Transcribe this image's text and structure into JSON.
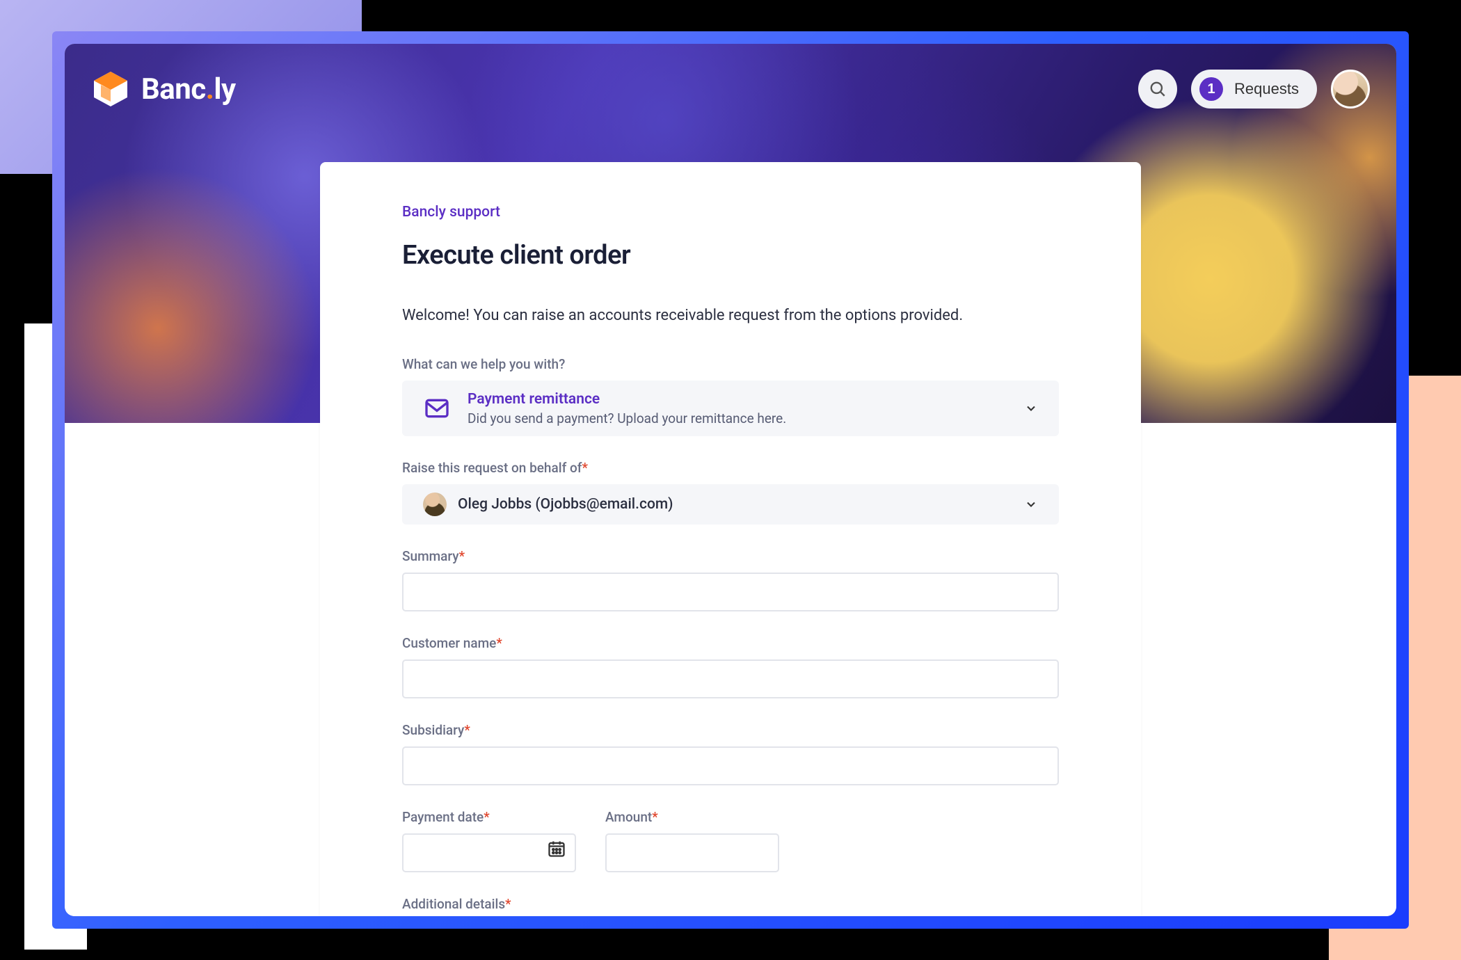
{
  "brand": {
    "name_pre": "Banc",
    "name_post": "ly"
  },
  "topbar": {
    "requests_count": "1",
    "requests_label": "Requests"
  },
  "breadcrumb": "Bancly support",
  "page_title": "Execute client order",
  "intro": "Welcome! You can raise an accounts receivable request from the options provided.",
  "labels": {
    "help_with": "What can we help you with?",
    "behalf_of": "Raise this request on behalf of",
    "summary": "Summary",
    "customer_name": "Customer name",
    "subsidiary": "Subsidiary",
    "payment_date": "Payment date",
    "amount": "Amount",
    "additional_details": "Additional details"
  },
  "help_option": {
    "title": "Payment remittance",
    "subtitle": "Did you send a payment? Upload your remittance here."
  },
  "behalf_person": "Oleg Jobbs (Ojobbs@email.com)",
  "fields": {
    "summary": "",
    "customer_name": "",
    "subsidiary": "",
    "payment_date": "",
    "amount": "",
    "additional_details": ""
  },
  "required_marker": "*"
}
